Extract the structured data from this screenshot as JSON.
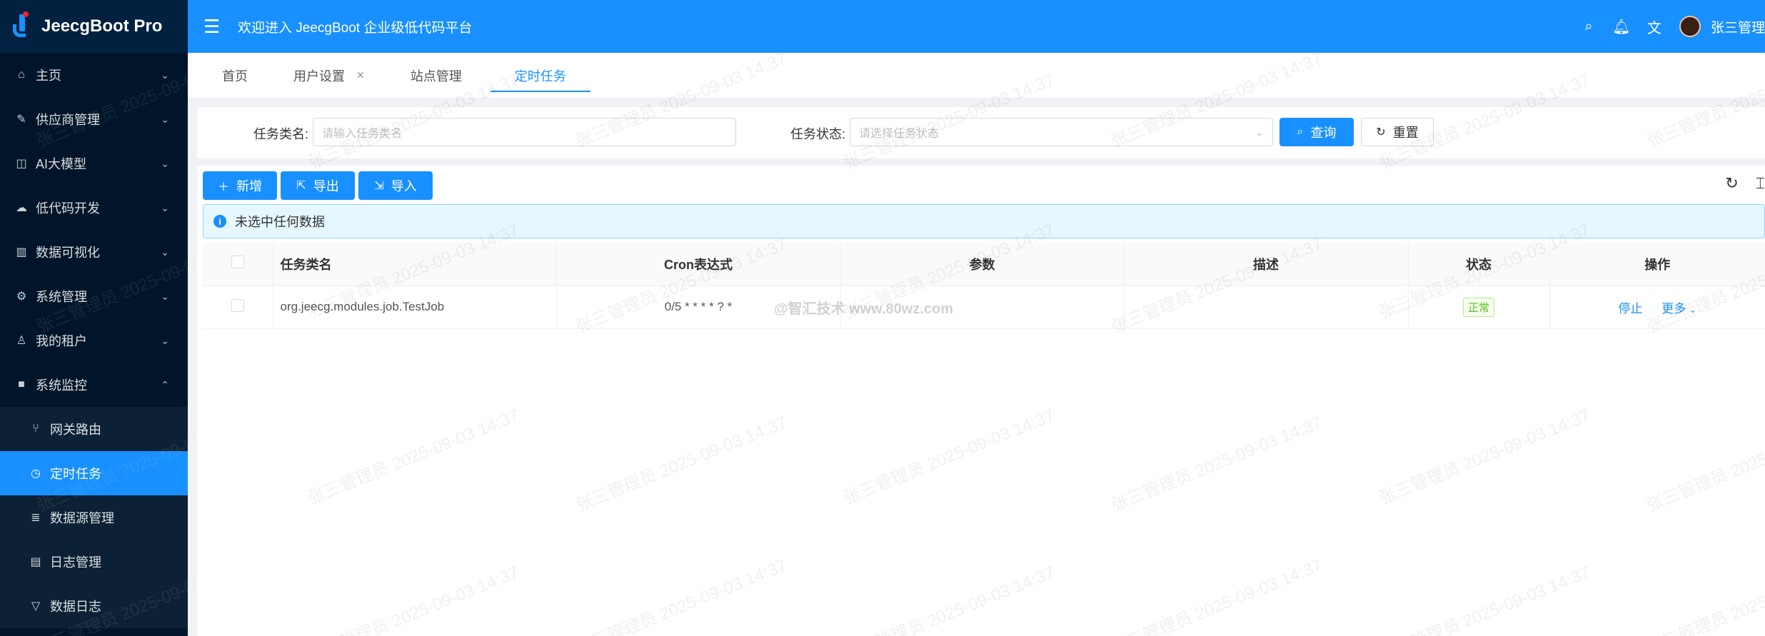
{
  "app": {
    "name": "JeecgBoot Pro"
  },
  "sidebar": {
    "items": [
      {
        "icon": "home-icon",
        "label": "主页"
      },
      {
        "icon": "supplier-icon",
        "label": "供应商管理"
      },
      {
        "icon": "ai-model-icon",
        "label": "AI大模型"
      },
      {
        "icon": "cloud-icon",
        "label": "低代码开发"
      },
      {
        "icon": "chart-icon",
        "label": "数据可视化"
      },
      {
        "icon": "gear-icon",
        "label": "系统管理"
      },
      {
        "icon": "user-icon",
        "label": "我的租户"
      },
      {
        "icon": "video-icon",
        "label": "系统监控"
      }
    ],
    "subitems": [
      {
        "icon": "branch-icon",
        "label": "网关路由"
      },
      {
        "icon": "clock-icon",
        "label": "定时任务"
      },
      {
        "icon": "database-icon",
        "label": "数据源管理"
      },
      {
        "icon": "log-icon",
        "label": "日志管理"
      },
      {
        "icon": "filter-icon",
        "label": "数据日志"
      }
    ]
  },
  "header": {
    "welcome": "欢迎进入 JeecgBoot 企业级低代码平台",
    "username": "张三管理"
  },
  "tabs": [
    {
      "label": "首页"
    },
    {
      "label": "用户设置"
    },
    {
      "label": "站点管理"
    },
    {
      "label": "定时任务"
    }
  ],
  "search": {
    "name_label": "任务类名:",
    "name_placeholder": "请输入任务类名",
    "status_label": "任务状态:",
    "status_placeholder": "请选择任务状态",
    "query_label": "查询",
    "reset_label": "重置"
  },
  "toolbar": {
    "add_label": "新增",
    "export_label": "导出",
    "import_label": "导入"
  },
  "alert": {
    "text": "未选中任何数据"
  },
  "table": {
    "columns": [
      "任务类名",
      "Cron表达式",
      "参数",
      "描述",
      "状态",
      "操作"
    ],
    "rows": [
      {
        "class_name": "org.jeecg.modules.job.TestJob",
        "cron": "0/5 * * * * ? *",
        "params": "",
        "description": "",
        "status": "正常",
        "action_stop": "停止",
        "action_more": "更多"
      }
    ]
  },
  "watermark": {
    "text": "张三管理员 2025-09-03 14:37",
    "brand": "@智汇技术  www.80wz.com"
  },
  "colors": {
    "primary": "#1890ff",
    "sidebar_bg": "#001529",
    "success": "#52c41a"
  }
}
